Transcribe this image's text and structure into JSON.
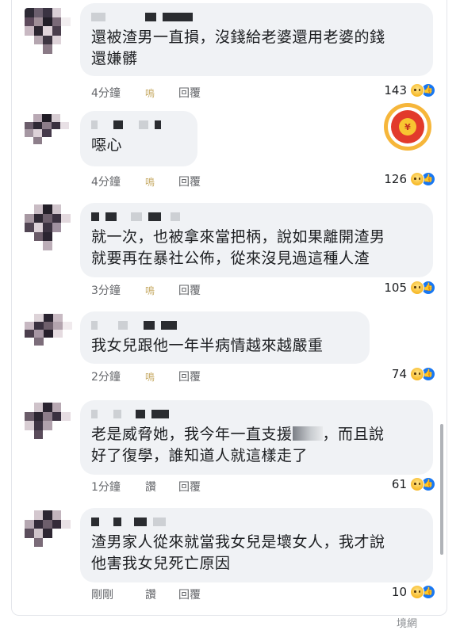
{
  "colors": {
    "bubble": "#f0f2f5",
    "text": "#1c1e21",
    "meta": "#65676b",
    "like": "#1877f2",
    "sad": "#f7b928",
    "floating": "#e23a2b"
  },
  "comments": [
    {
      "text_lines": [
        "還被渣男一直損，沒錢給老婆還用老婆的錢",
        "還嫌髒"
      ],
      "time": "4分鐘",
      "mid": "鳴",
      "reply": "回覆",
      "count": "143"
    },
    {
      "text_lines": [
        "噁心"
      ],
      "time": "4分鐘",
      "mid": "鳴",
      "reply": "回覆",
      "count": "126"
    },
    {
      "text_lines": [
        "就一次，也被拿來當把柄，說如果離開渣男",
        "就要再在暴社公佈，從來沒見過這種人渣"
      ],
      "time": "3分鐘",
      "mid": "鳴",
      "reply": "回覆",
      "count": "105"
    },
    {
      "text_lines": [
        "我女兒跟他一年半病情越來越嚴重"
      ],
      "time": "2分鐘",
      "mid": "鳴",
      "reply": "回覆",
      "count": "74"
    },
    {
      "text_lines": [
        "老是威脅她，我今年一直支援",
        "好了復學，誰知道人就這樣走了"
      ],
      "text_after_blur": "，而且說",
      "time": "1分鐘",
      "mid": "讚",
      "reply": "回覆",
      "count": "61"
    },
    {
      "text_lines": [
        "渣男家人從來就當我女兒是壞女人，我才說",
        "他害我女兒死亡原因"
      ],
      "time": "剛剛",
      "mid": "讚",
      "reply": "回覆",
      "count": "10"
    }
  ],
  "icons": {
    "sad": "sad-reaction-icon",
    "like": "like-reaction-icon",
    "floating": "red-envelope-icon"
  },
  "floating_button": {
    "coin": "¥"
  },
  "watermark": "境網"
}
